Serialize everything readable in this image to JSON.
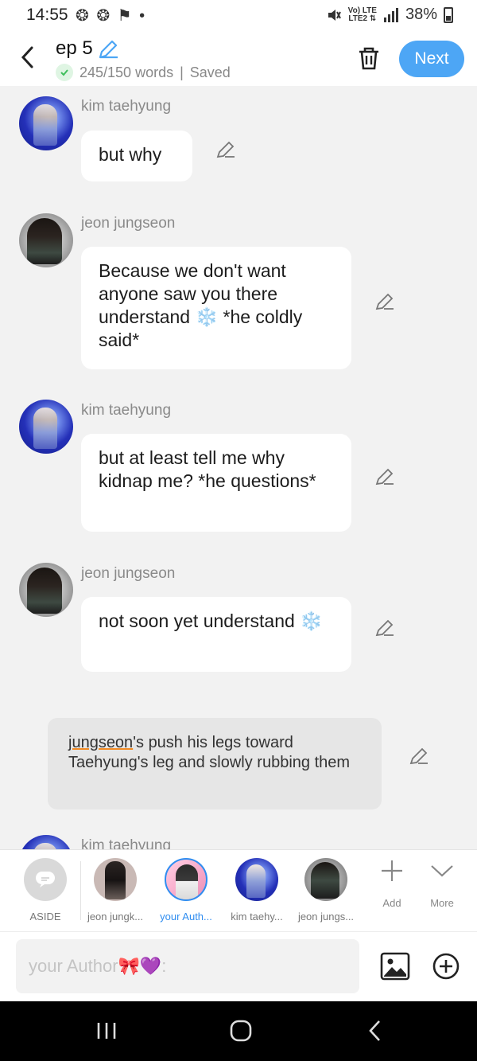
{
  "status_bar": {
    "time": "14:55",
    "battery": "38%",
    "left_icons": "❂ ❂ ⚑ •",
    "network": "Vo) LTE\nLTE2"
  },
  "header": {
    "title": "ep 5",
    "word_count": "245/150 words",
    "save_status": "Saved",
    "next_label": "Next"
  },
  "messages": [
    {
      "speaker": "kim taehyung",
      "text": "but why"
    },
    {
      "speaker": "jeon jungseon",
      "text": "Because we don't want anyone saw you there understand ❄️ *he coldly said*"
    },
    {
      "speaker": "kim taehyung",
      "text": "but at least tell me why kidnap me? *he questions*"
    },
    {
      "speaker": "jeon jungseon",
      "text": "not soon yet understand ❄️"
    }
  ],
  "aside": {
    "name_part": "jungseon",
    "text": "'s push his legs toward Taehyung's leg and slowly rubbing them"
  },
  "partial_message": {
    "speaker": "kim taehyung"
  },
  "characters": [
    {
      "label": "ASIDE",
      "icon": "aside-icon"
    },
    {
      "label": "jeon jungk...",
      "icon": "avatar-jeon-jungkook"
    },
    {
      "label": "your Auth...",
      "icon": "avatar-your-author",
      "active": true
    },
    {
      "label": "kim taehy...",
      "icon": "avatar-kim-taehyung"
    },
    {
      "label": "jeon jungs...",
      "icon": "avatar-jeon-jungseon"
    }
  ],
  "tools": {
    "add_label": "Add",
    "more_label": "More"
  },
  "input": {
    "placeholder": "your Author🎀💜:"
  },
  "colors": {
    "accent": "#4da6f5",
    "active_tab": "#2f8df0",
    "underline": "#f28a22",
    "background": "#f2f2f2"
  }
}
